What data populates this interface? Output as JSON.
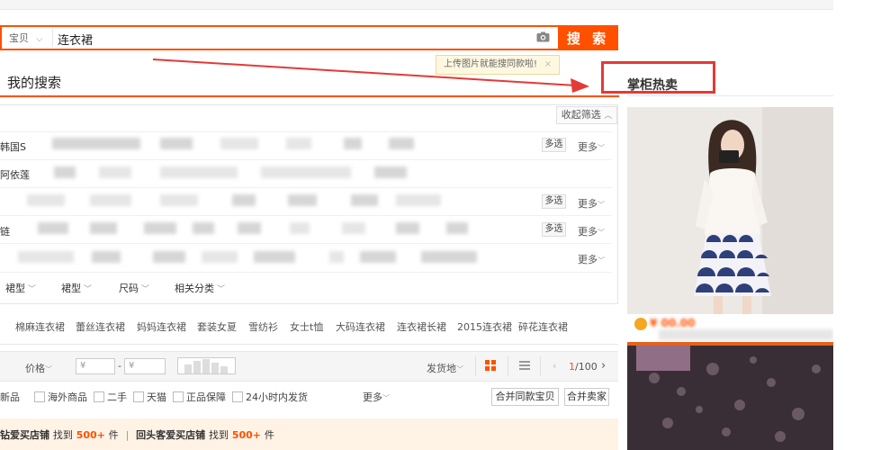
{
  "search": {
    "scope": "宝贝",
    "query": "连衣裙",
    "button": "搜 索",
    "tooltip": "上传图片就能搜同款啦!",
    "tooltip_close": "×"
  },
  "section_title": "我的搜索",
  "hot_title": "掌柜热卖",
  "filters": {
    "collapse": "收起筛选",
    "row_labels": [
      "韩国S",
      "阿依莲",
      "",
      "链",
      ""
    ],
    "multi_label": "多选",
    "more_label": "更多",
    "attributes": [
      "裙型",
      "裙型",
      "尺码",
      "相关分类"
    ]
  },
  "related_searches": [
    "棉麻连衣裙",
    "蕾丝连衣裙",
    "妈妈连衣裙",
    "套装女夏",
    "雪纺衫",
    "女士t恤",
    "大码连衣裙",
    "连衣裙长裙",
    "2015连衣裙",
    "碎花连衣裙"
  ],
  "sort": {
    "price_label": "价格",
    "price_from": "¥",
    "price_to": "¥",
    "dash": "-",
    "location": "发货地",
    "page_current": "1",
    "page_total": "/100"
  },
  "checkboxes": [
    "新品",
    "海外商品",
    "二手",
    "天猫",
    "正品保障",
    "24小时内发货"
  ],
  "more_filters": "更多",
  "merge_buttons": [
    "合并同款宝贝",
    "合并卖家"
  ],
  "promo": {
    "part1": "钻爱买店铺",
    "found1": "找到",
    "count1": "500+",
    "unit1": "件",
    "sep": "|",
    "part2": "回头客爱买店铺",
    "found2": "找到",
    "count2": "500+",
    "unit2": "件"
  },
  "product": {
    "price": "¥ 00.00"
  },
  "colors": {
    "accent": "#ff5000",
    "annotation": "#e53935"
  }
}
